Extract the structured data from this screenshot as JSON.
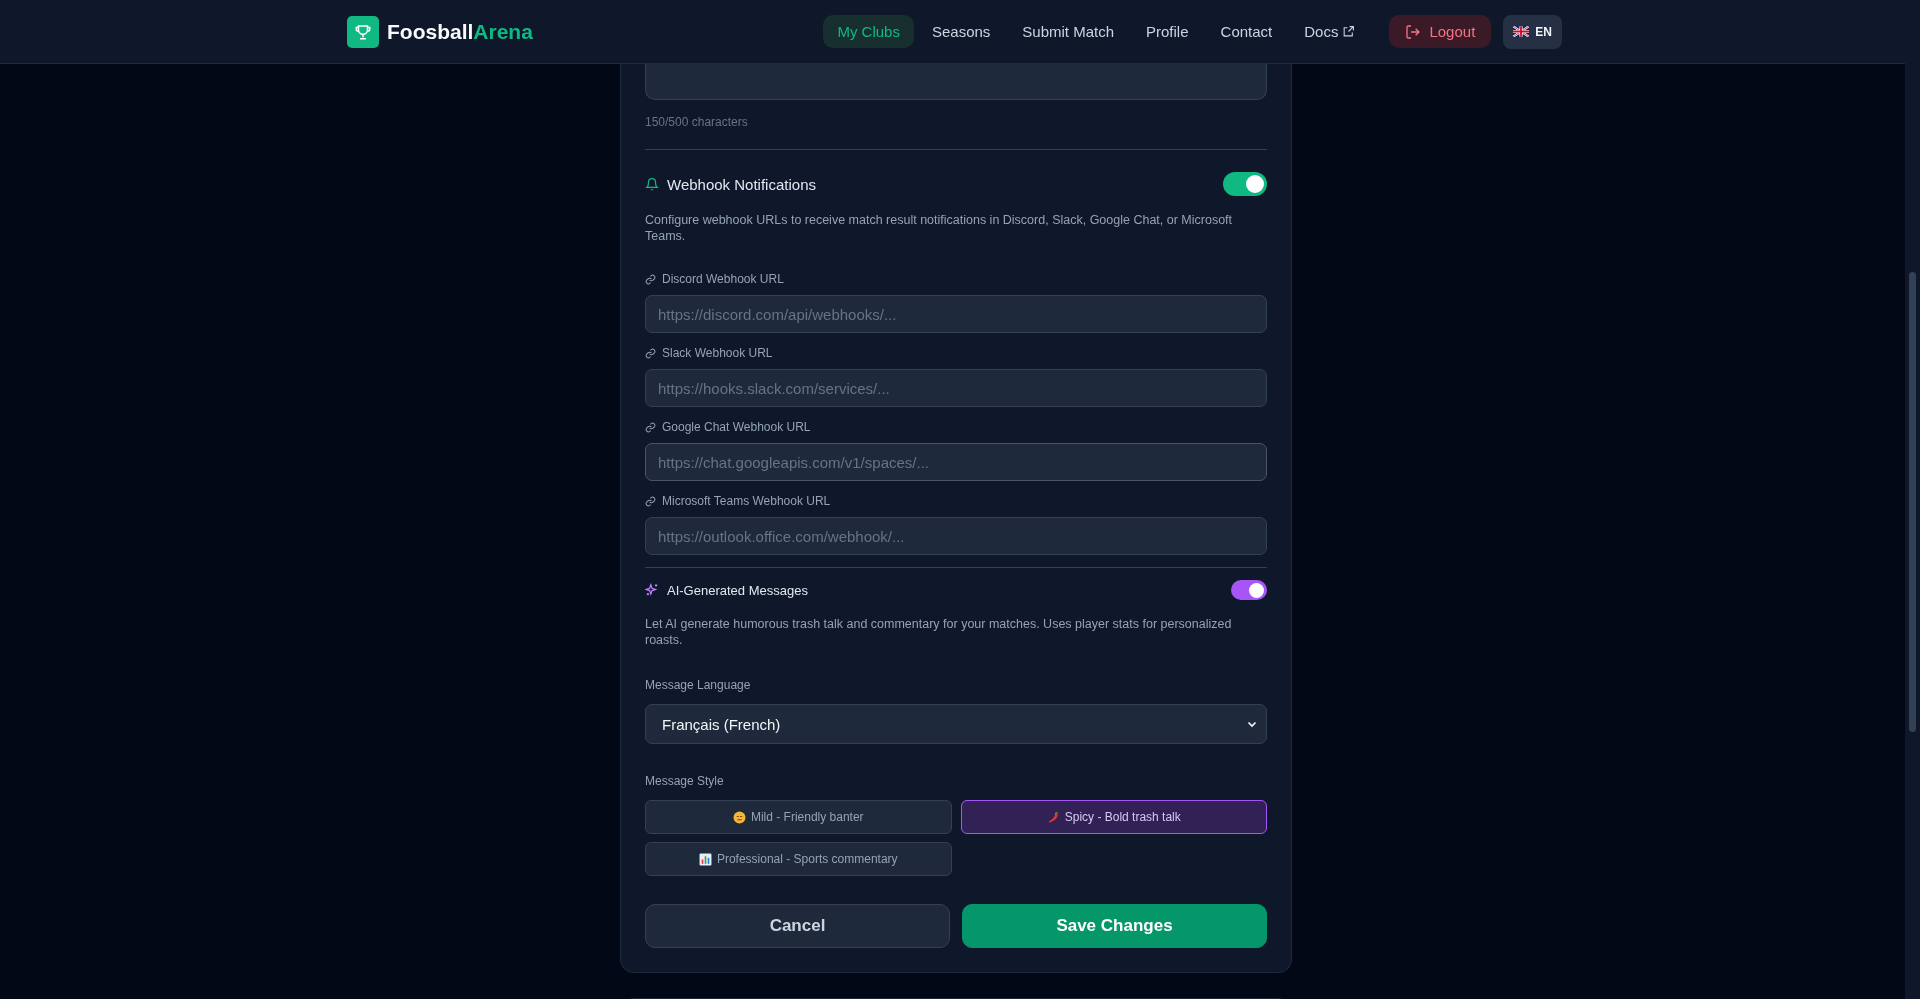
{
  "header": {
    "brand": {
      "first": "Foosball",
      "second": "Arena"
    },
    "nav": [
      {
        "label": "My Clubs",
        "selected": true,
        "kind": "link"
      },
      {
        "label": "Seasons",
        "selected": false,
        "kind": "link"
      },
      {
        "label": "Submit Match",
        "selected": false,
        "kind": "link"
      },
      {
        "label": "Profile",
        "selected": false,
        "kind": "link"
      },
      {
        "label": "Contact",
        "selected": false,
        "kind": "link"
      },
      {
        "label": "Docs",
        "selected": false,
        "kind": "external"
      }
    ],
    "logout": "Logout",
    "language": "EN"
  },
  "form": {
    "char_count": "150/500 characters",
    "webhooks": {
      "title": "Webhook Notifications",
      "on": true,
      "description": "Configure webhook URLs to receive match result notifications in Discord, Slack, Google Chat, or Microsoft Teams.",
      "fields": [
        {
          "label": "Discord Webhook URL",
          "placeholder": "https://discord.com/api/webhooks/...",
          "focused": false
        },
        {
          "label": "Slack Webhook URL",
          "placeholder": "https://hooks.slack.com/services/...",
          "focused": false
        },
        {
          "label": "Google Chat Webhook URL",
          "placeholder": "https://chat.googleapis.com/v1/spaces/...",
          "focused": true
        },
        {
          "label": "Microsoft Teams Webhook URL",
          "placeholder": "https://outlook.office.com/webhook/...",
          "focused": false
        }
      ]
    },
    "ai": {
      "title": "AI-Generated Messages",
      "on": true,
      "description": "Let AI generate humorous trash talk and commentary for your matches. Uses player stats for personalized roasts.",
      "language_label": "Message Language",
      "language_value": "Français (French)",
      "style_label": "Message Style",
      "styles": [
        {
          "kind": "mild",
          "label": "Mild - Friendly banter",
          "selected": false
        },
        {
          "kind": "spicy",
          "label": "Spicy - Bold trash talk",
          "selected": true
        },
        {
          "kind": "professional",
          "label": "Professional - Sports commentary",
          "selected": false
        }
      ]
    },
    "buttons": {
      "cancel": "Cancel",
      "save": "Save Changes"
    }
  }
}
